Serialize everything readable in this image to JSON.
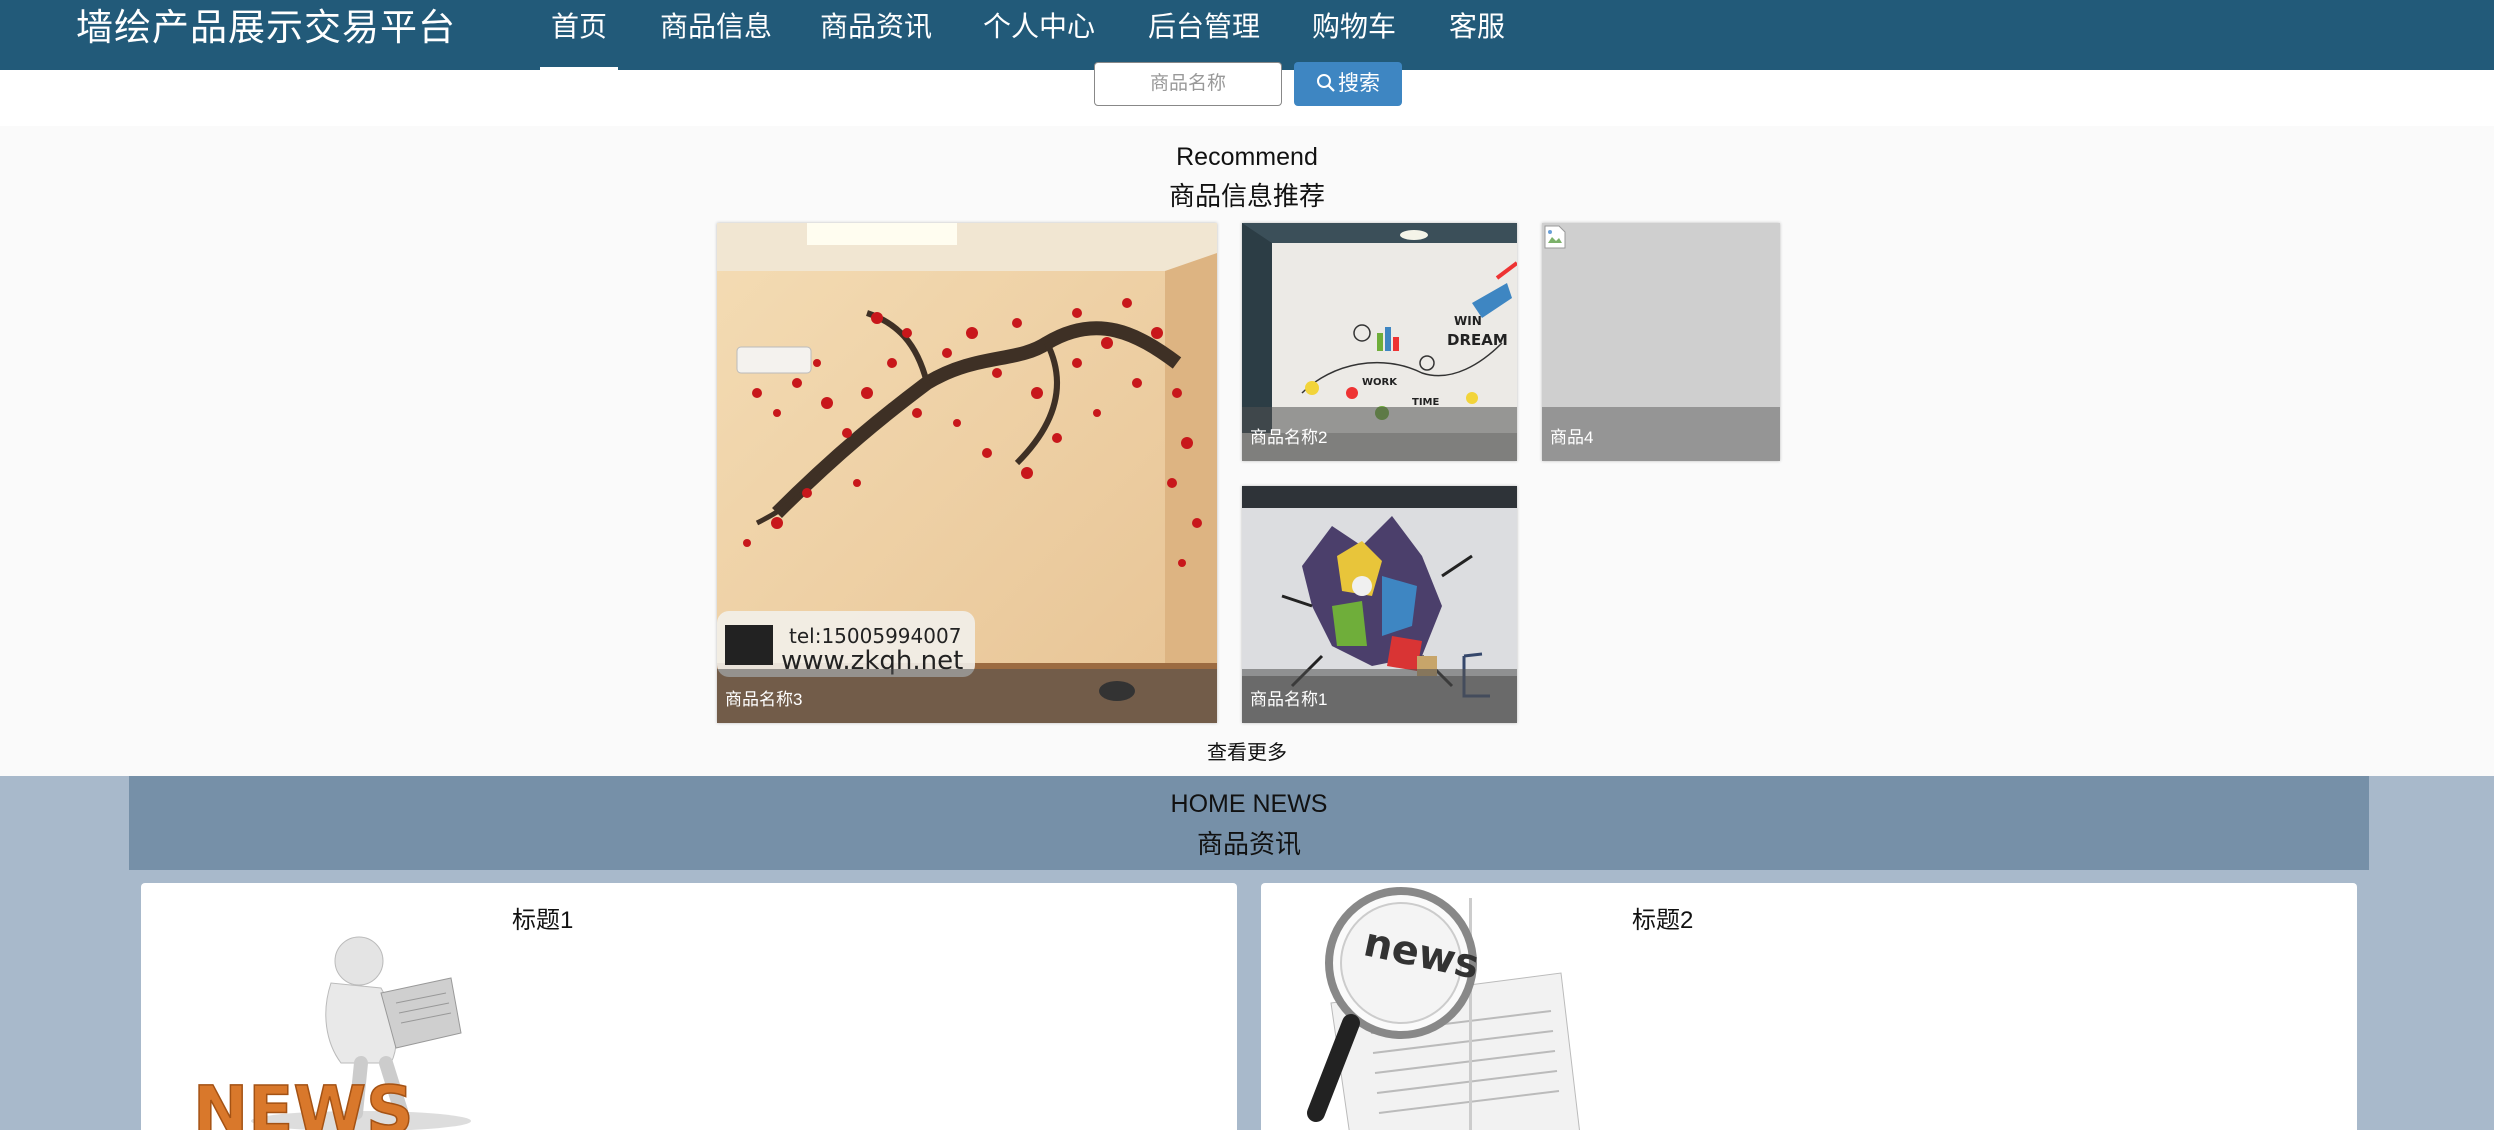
{
  "nav": {
    "brand": "墙绘产品展示交易平台",
    "items": [
      {
        "label": "首页",
        "active": true
      },
      {
        "label": "商品信息"
      },
      {
        "label": "商品资讯"
      },
      {
        "label": "个人中心"
      },
      {
        "label": "后台管理"
      },
      {
        "label": "购物车"
      },
      {
        "label": "客服"
      }
    ]
  },
  "search": {
    "placeholder": "商品名称",
    "button_label": "搜索",
    "button_icon": "search-icon"
  },
  "recommend": {
    "title_en": "Recommend",
    "title_cn": "商品信息推荐",
    "items": [
      {
        "caption": "商品名称3",
        "image_text_tel": "tel:15005994007",
        "image_text_url": "www.zkqh.net"
      },
      {
        "caption": "商品名称2",
        "image_words": [
          "WIN",
          "WORK",
          "DREAM",
          "TIME"
        ]
      },
      {
        "caption": "商品4"
      },
      {
        "caption": "商品名称1"
      }
    ],
    "more_label": "查看更多"
  },
  "news": {
    "title_en": "HOME NEWS",
    "title_cn": "商品资讯",
    "items": [
      {
        "title": "标题1",
        "image_text": "NEWS"
      },
      {
        "title": "标题2",
        "image_text": "news"
      }
    ]
  },
  "colors": {
    "nav_bg": "#225a79",
    "search_button": "#3e86c2",
    "news_bg": "#a8b9cb",
    "news_header": "#7690a8"
  }
}
